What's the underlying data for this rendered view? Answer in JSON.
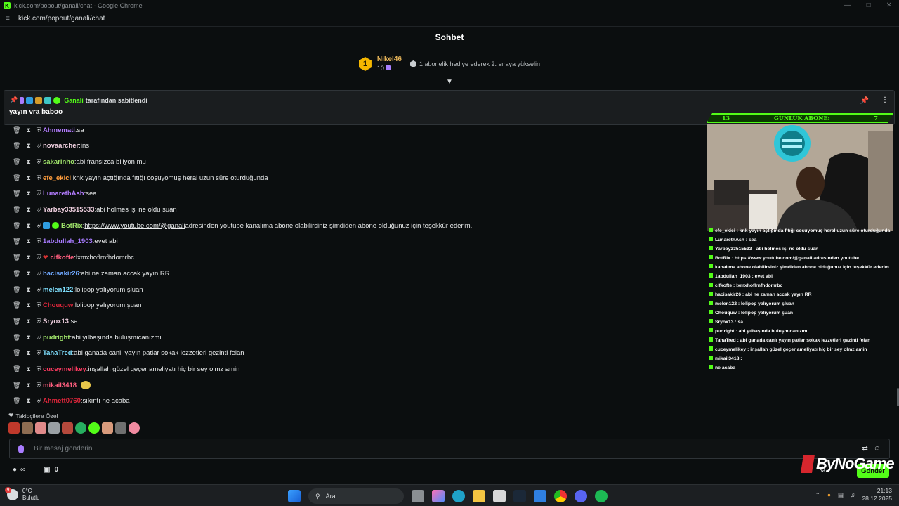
{
  "window": {
    "title": "kick.com/popout/ganali/chat - Google Chrome",
    "url": "kick.com/popout/ganali/chat"
  },
  "chat": {
    "header_title": "Sohbet",
    "leaderboard": {
      "rank": "1",
      "username": "Nikel46",
      "count": "10",
      "hint": "1 abonelik hediye ederek 2. sıraya yükselin"
    },
    "pinned": {
      "by_user": "Ganali",
      "by_text": "tarafından sabitlendi",
      "message": "yayın vra baboo"
    },
    "messages": [
      {
        "user": "Ahmemati",
        "color": "#b37cff",
        "text": "sa"
      },
      {
        "user": "novaarcher",
        "color": "#f0d0e0",
        "text": "ins"
      },
      {
        "user": "sakarinho",
        "color": "#9fe36a",
        "text": "abi fransızca biliyon mu"
      },
      {
        "user": "efe_ekici",
        "color": "#ff9d3d",
        "text": "knk yayın açtığında fıtığı coşuyomuş heral uzun süre oturduğunda"
      },
      {
        "user": "LunarethAsh",
        "color": "#b37cff",
        "text": "sea"
      },
      {
        "user": "Yarbay33515533",
        "color": "#f0d0e0",
        "text": "abi holmes işi ne oldu suan"
      },
      {
        "user": "BotRix",
        "color": "#9fe36a",
        "text_before": "",
        "link": "https://www.youtube.com/@ganali",
        "text": "adresinden youtube kanalıma abone olabilirsiniz şimdiden abone olduğunuz için teşekkür ederim."
      },
      {
        "user": "1abdullah_1903",
        "color": "#a87bff",
        "text": "evet abi"
      },
      {
        "user": "cifkofte",
        "color": "#ff5e7e",
        "text": "lxmxhoflrnfhdomrbc"
      },
      {
        "user": "hacisakir26",
        "color": "#6fa8ff",
        "text": "abi ne zaman accak yayın RR"
      },
      {
        "user": "melen122",
        "color": "#7ee0ff",
        "text": "lolipop yalıyorum şluan"
      },
      {
        "user": "Chouquw",
        "color": "#e0263b",
        "text": "lolipop yalıyorum şuan"
      },
      {
        "user": "Sryox13",
        "color": "#f0d0e0",
        "text": "sa"
      },
      {
        "user": "pudright",
        "color": "#9fe36a",
        "text": "abi yılbaşında buluşmıcanızmı"
      },
      {
        "user": "TahaTred",
        "color": "#7ee0ff",
        "text": "abi ganada canlı yayın patlar sokak lezzetleri gezinti felan"
      },
      {
        "user": "cuceymelikey",
        "color": "#ff3b62",
        "text": "inşallah güzel geçer ameliyatı hiç bir sey olmz amin"
      },
      {
        "user": "mikail3418",
        "color": "#ff5e7e",
        "text": ""
      },
      {
        "user": "Ahmett0760",
        "color": "#e0263b",
        "text": "sıkıntı ne acaba"
      }
    ],
    "emote_section_label": "Takipçilere Özel",
    "composer_placeholder": "Bir mesaj gönderin",
    "send_label": "Gönder",
    "viewer_count": "0"
  },
  "overlay": {
    "bar_left": "13",
    "bar_title": "GÜNLÜK ABONE:",
    "bar_right": "7",
    "chat_lines": [
      "efe_ekici : knk yayın açtığında fıtığı coşuyomuş heral uzun süre oturduğunda",
      "LunarethAsh : sea",
      "Yarbay33515533 : abi holmes işi ne oldu suan",
      "BotRix : https://www.youtube.com/@ganali adresinden youtube",
      "kanalıma abone olabilirsiniz şimdiden abone olduğunuz için teşekkür ederim.",
      "1abdullah_1903 : evet abi",
      "cifkofte : lxmxhoflrnfhdomrbc",
      "hacisakir26 : abi ne zaman accak yayın RR",
      "melen122 : lolipop yalıyorum şluan",
      "Chouquw : lolipop yalıyorum şuan",
      "Sryox13 : sa",
      "pudright : abi yılbaşında buluşmıcanızmı",
      "TahaTred : abi ganada canlı yayın patlar sokak lezzetleri gezinti felan",
      "cuceymelikey : inşallah güzel geçer ameliyatı hiç bir sey olmz amin",
      "mikail3418 :",
      "ne acaba"
    ],
    "watermark": "ByNoGame"
  },
  "taskbar": {
    "weather_temp": "0°C",
    "weather_desc": "Bulutlu",
    "weather_badge": "9",
    "search_label": "Ara",
    "time": "21:13",
    "date": "28.12.2025"
  }
}
